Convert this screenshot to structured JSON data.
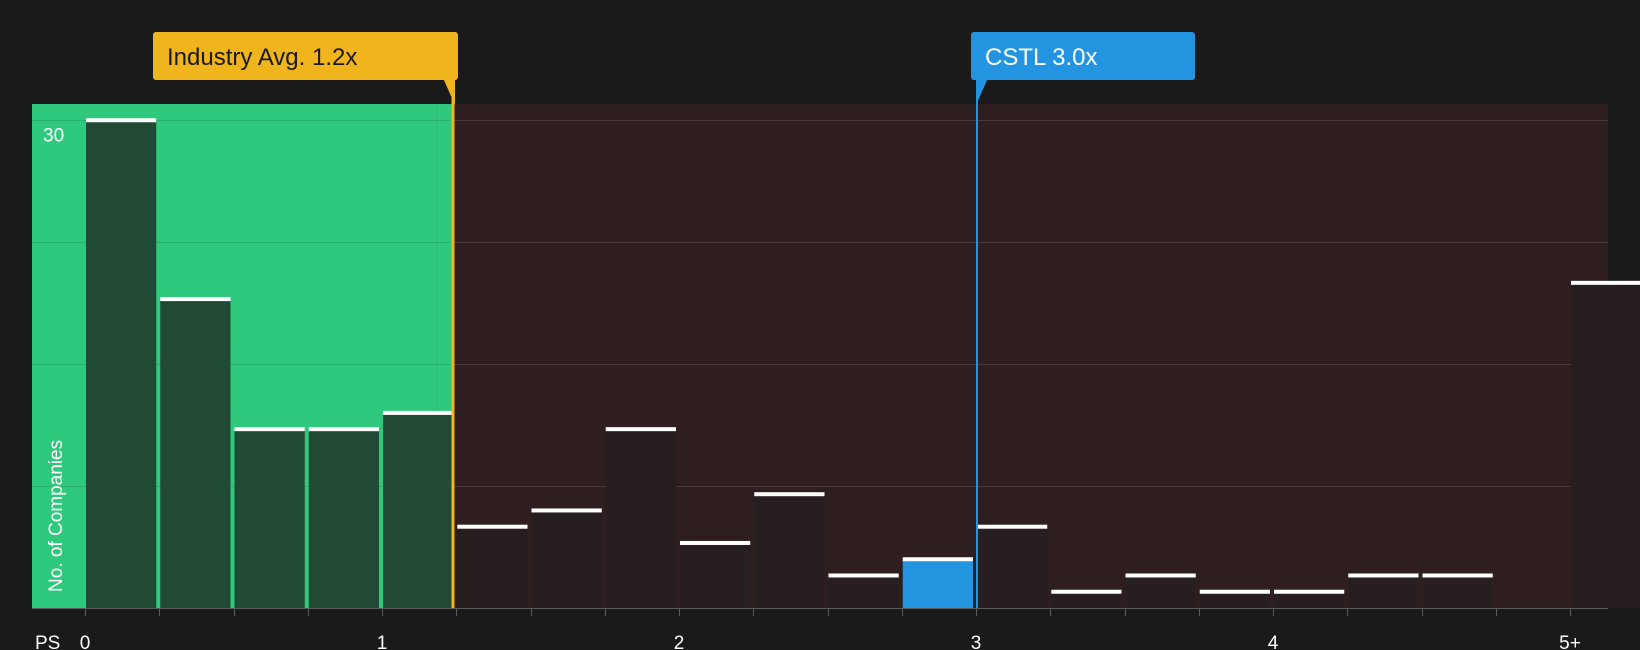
{
  "chart_data": {
    "type": "bar",
    "xlabel": "PS",
    "ylabel": "No. of Companies",
    "x_ticks": [
      "0",
      "1",
      "2",
      "3",
      "4",
      "5+"
    ],
    "y_ticks": [
      30
    ],
    "ylim": [
      0,
      31
    ],
    "bin_width": 0.25,
    "bins": [
      {
        "start": 0.0,
        "value": 30
      },
      {
        "start": 0.25,
        "value": 19
      },
      {
        "start": 0.5,
        "value": 11
      },
      {
        "start": 0.75,
        "value": 11
      },
      {
        "start": 1.0,
        "value": 12
      },
      {
        "start": 1.25,
        "value": 5
      },
      {
        "start": 1.5,
        "value": 6
      },
      {
        "start": 1.75,
        "value": 11
      },
      {
        "start": 2.0,
        "value": 4
      },
      {
        "start": 2.25,
        "value": 7
      },
      {
        "start": 2.5,
        "value": 2
      },
      {
        "start": 2.75,
        "value": 3,
        "highlight": true
      },
      {
        "start": 3.0,
        "value": 5
      },
      {
        "start": 3.25,
        "value": 1
      },
      {
        "start": 3.5,
        "value": 2
      },
      {
        "start": 3.75,
        "value": 1
      },
      {
        "start": 4.0,
        "value": 1
      },
      {
        "start": 4.25,
        "value": 2
      },
      {
        "start": 4.5,
        "value": 2
      },
      {
        "start": 5.0,
        "value": 20
      }
    ],
    "markers": [
      {
        "name": "industry",
        "label": "Industry Avg. 1.2x",
        "value": 1.2,
        "color": "#f0b41c"
      },
      {
        "name": "company",
        "label": "CSTL 3.0x",
        "value": 3.0,
        "color": "#2394e0"
      }
    ],
    "colors": {
      "below_region": "#2ec97c",
      "above_region": "#2f1e1f",
      "bar_in_green": "#214a35",
      "bar_in_red": "#271f1f",
      "highlight": "#2394e0",
      "cap": "#ffffff",
      "grid": "#4a3a3b"
    },
    "grid": true
  }
}
